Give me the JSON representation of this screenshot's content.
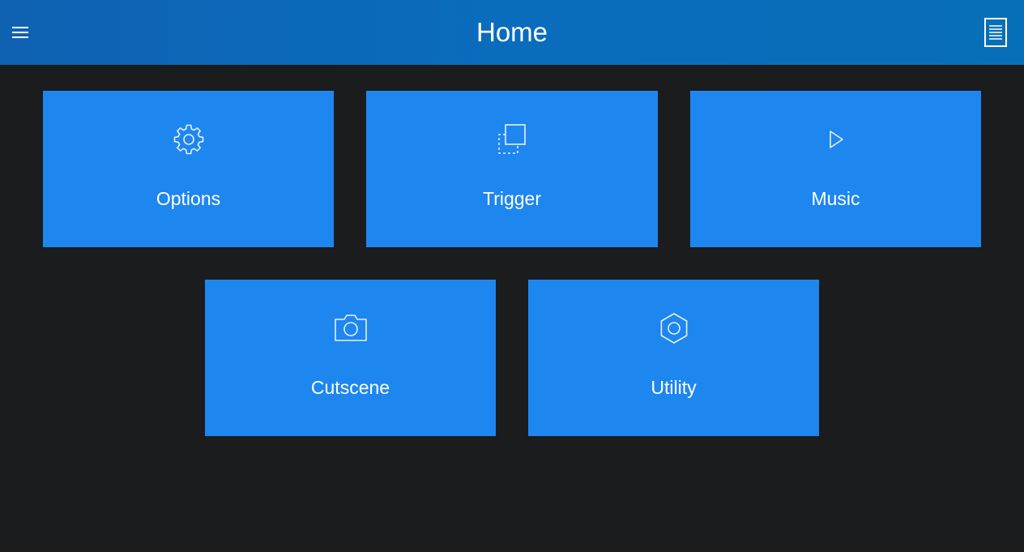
{
  "header": {
    "title": "Home",
    "menu_icon": "hamburger-menu-icon",
    "doc_icon": "document-icon",
    "background": "#0a6cbd"
  },
  "tiles": [
    {
      "label": "Options",
      "icon": "gear-icon"
    },
    {
      "label": "Trigger",
      "icon": "select-region-icon"
    },
    {
      "label": "Music",
      "icon": "play-icon"
    },
    {
      "label": "Cutscene",
      "icon": "camera-icon"
    },
    {
      "label": "Utility",
      "icon": "hex-nut-icon"
    }
  ],
  "colors": {
    "page_background": "#1b1c1e",
    "tile_background": "#1e86ef",
    "text": "#ffffff"
  }
}
